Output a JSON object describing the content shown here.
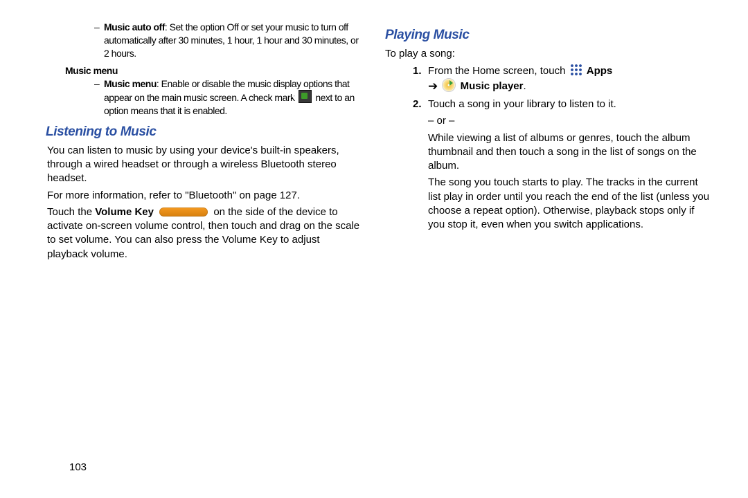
{
  "page_number": "103",
  "left": {
    "music_auto_off": {
      "label": "Music auto off",
      "text_after": ": Set the option Off or set your music to turn off automatically after 30 minutes, 1 hour, 1 hour and 30 minutes, or 2 hours."
    },
    "music_menu_heading": "Music menu",
    "music_menu": {
      "label": "Music menu",
      "text_before": ": Enable or disable the music display options that appear on the main music screen. A check mark ",
      "text_after": " next to an option means that it is enabled."
    },
    "listening_heading": "Listening to Music",
    "p1": "You can listen to music by using your device's built-in speakers, through a wired headset or through a wireless Bluetooth stereo headset.",
    "p2_a": "For more information, refer to ",
    "p2_ref": "\"Bluetooth\"",
    "p2_b": " on page 127.",
    "p3_a": "Touch the ",
    "p3_b": "Volume Key",
    "p3_c": " on the side of the device to activate on-screen volume control, then touch and drag on the scale to set volume. You can also press the Volume Key to adjust playback volume."
  },
  "right": {
    "playing_heading": "Playing Music",
    "intro": "To play a song:",
    "step1_num": "1.",
    "step1_a": "From the Home screen, touch ",
    "step1_apps": "Apps",
    "step1_arrow": "➔",
    "step1_mp": "Music player",
    "step1_period": ".",
    "step2_num": "2.",
    "step2": "Touch a song in your library to listen to it.",
    "or": "– or –",
    "step2_cont1": "While viewing a list of albums or genres, touch the album thumbnail and then touch a song in the list of songs on the album.",
    "step2_cont2": "The song you touch starts to play. The tracks in the current list play in order until you reach the end of the list (unless you choose a repeat option). Otherwise, playback stops only if you stop it, even when you switch applications."
  }
}
